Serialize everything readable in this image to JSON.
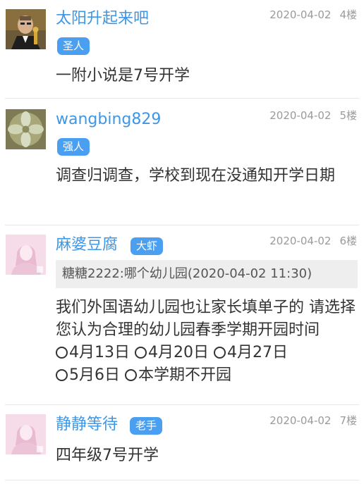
{
  "posts": [
    {
      "username": "太阳升起来吧",
      "badge": "圣人",
      "date": "2020-04-02",
      "floor": "4楼",
      "content": "一附小说是7号开学"
    },
    {
      "username": "wangbing829",
      "badge": "强人",
      "date": "2020-04-02",
      "floor": "5楼",
      "content": "调查归调查，学校到现在没通知开学日期"
    },
    {
      "username": "麻婆豆腐",
      "badge": "大虾",
      "date": "2020-04-02",
      "floor": "6楼",
      "quote": "糖糖2222:哪个幼儿园(2020-04-02 11:30)",
      "content": "我们外国语幼儿园也让家长填单子的 请选择您认为合理的幼儿园春季学期开园时间",
      "options": [
        "4月13日",
        "4月20日",
        "4月27日",
        "5月6日",
        "本学期不开园"
      ]
    },
    {
      "username": "静静等待",
      "badge": "老手",
      "date": "2020-04-02",
      "floor": "7楼",
      "content": "四年级7号开学"
    }
  ],
  "colors": {
    "username": "#3d96e6",
    "badge": "#4a9ff0",
    "meta": "#9a9a9a",
    "quote_bg": "#eeeeee"
  }
}
